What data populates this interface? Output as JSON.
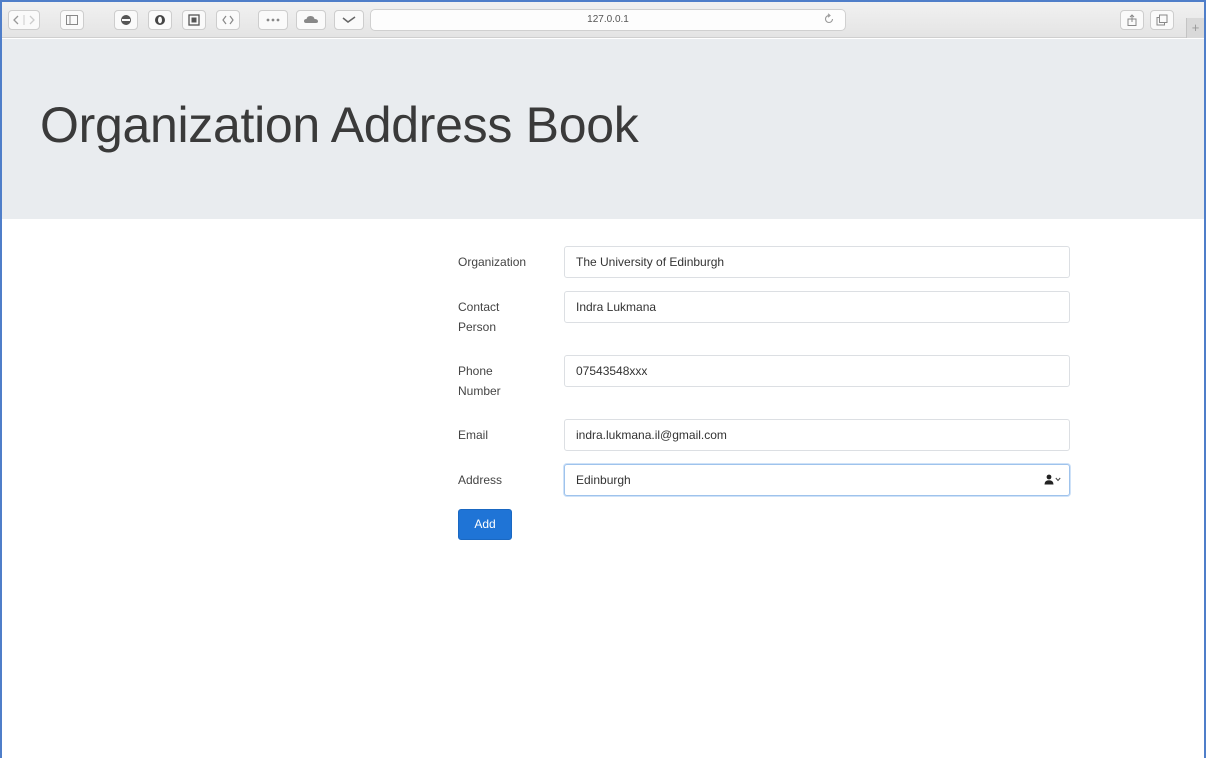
{
  "browser": {
    "url": "127.0.0.1"
  },
  "header": {
    "title": "Organization Address Book"
  },
  "form": {
    "organization": {
      "label": "Organization",
      "value": "The University of Edinburgh"
    },
    "contact_person": {
      "label_line1": "Contact",
      "label_line2": "Person",
      "value": "Indra Lukmana"
    },
    "phone_number": {
      "label_line1": "Phone",
      "label_line2": "Number",
      "value": "07543548xxx"
    },
    "email": {
      "label": "Email",
      "value": "indra.lukmana.il@gmail.com"
    },
    "address": {
      "label": "Address",
      "value": "Edinburgh"
    },
    "submit_label": "Add"
  },
  "colors": {
    "accent": "#1f74d6",
    "jumbotron_bg": "#e9ecef",
    "frame_border": "#4f7ec9"
  }
}
